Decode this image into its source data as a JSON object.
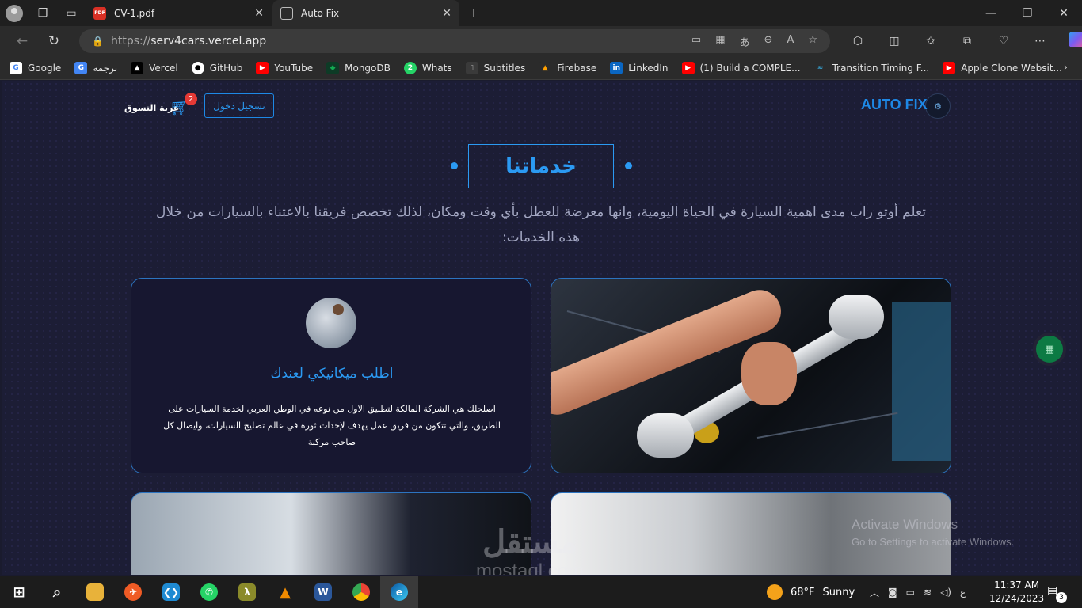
{
  "browser": {
    "tabs": [
      {
        "title": "CV-1.pdf",
        "icon": "pdf-icon",
        "active": false
      },
      {
        "title": "Auto Fix",
        "icon": "page-icon",
        "active": true
      }
    ],
    "url_scheme": "https://",
    "url_host": "serv4cars.vercel.app",
    "bookmarks": [
      {
        "label": "Google",
        "icon": "google-icon",
        "color": "#ffffff"
      },
      {
        "label": "ترجمة",
        "icon": "translate-icon",
        "color": "#4285f4"
      },
      {
        "label": "Vercel",
        "icon": "vercel-icon",
        "color": "#000000"
      },
      {
        "label": "GitHub",
        "icon": "github-icon",
        "color": "#ffffff"
      },
      {
        "label": "YouTube",
        "icon": "youtube-icon",
        "color": "#ff0000"
      },
      {
        "label": "MongoDB",
        "icon": "mongodb-icon",
        "color": "#13aa52"
      },
      {
        "label": "Whats",
        "icon": "whatsapp-icon",
        "color": "#25d366"
      },
      {
        "label": "Subtitles",
        "icon": "subtitles-icon",
        "color": "#555555"
      },
      {
        "label": "Firebase",
        "icon": "firebase-icon",
        "color": "#ffa000"
      },
      {
        "label": "LinkedIn",
        "icon": "linkedin-icon",
        "color": "#0a66c2"
      },
      {
        "label": "(1) Build a COMPLE...",
        "icon": "youtube-icon",
        "color": "#ff0000"
      },
      {
        "label": "Transition Timing F...",
        "icon": "tailwind-icon",
        "color": "#38bdf8"
      },
      {
        "label": "Apple Clone Websit...",
        "icon": "youtube-icon",
        "color": "#ff0000"
      }
    ]
  },
  "site": {
    "logo_text": "AUTO FIX",
    "login_label": "تسجيل دخول",
    "cart_label": "عربة التسوق",
    "cart_count": "2",
    "section_title": "خدماتنا",
    "intro_text": "تعلم أوتو راب مدى اهمية السيارة في الحياة اليومية، وانها معرضة للعطل بأي وقت ومكان، لذلك تخصص فريقنا بالاعتناء بالسيارات من خلال هذه الخدمات:",
    "service_card": {
      "title": "اطلب ميكانيكي لعندك",
      "body": "اصلحلك هي الشركة المالكة لتطبيق الاول من نوعه في الوطن العربي لخدمة السيارات على الطريق، والتي تتكون من فريق عمل يهدف لإحداث ثورة في عالم تصليح السيارات، وايصال كل صاحب مركبة"
    },
    "accent_color": "#2b9af3"
  },
  "overlay": {
    "activate_line1": "Activate Windows",
    "activate_line2": "Go to Settings to activate Windows.",
    "brand_ar": "مستقل",
    "brand_latin": "mostaql.com"
  },
  "taskbar": {
    "weather_temp": "68°F",
    "weather_desc": "Sunny",
    "lang": "ع",
    "time": "11:37 AM",
    "date": "12/24/2023",
    "notifications": "3"
  }
}
